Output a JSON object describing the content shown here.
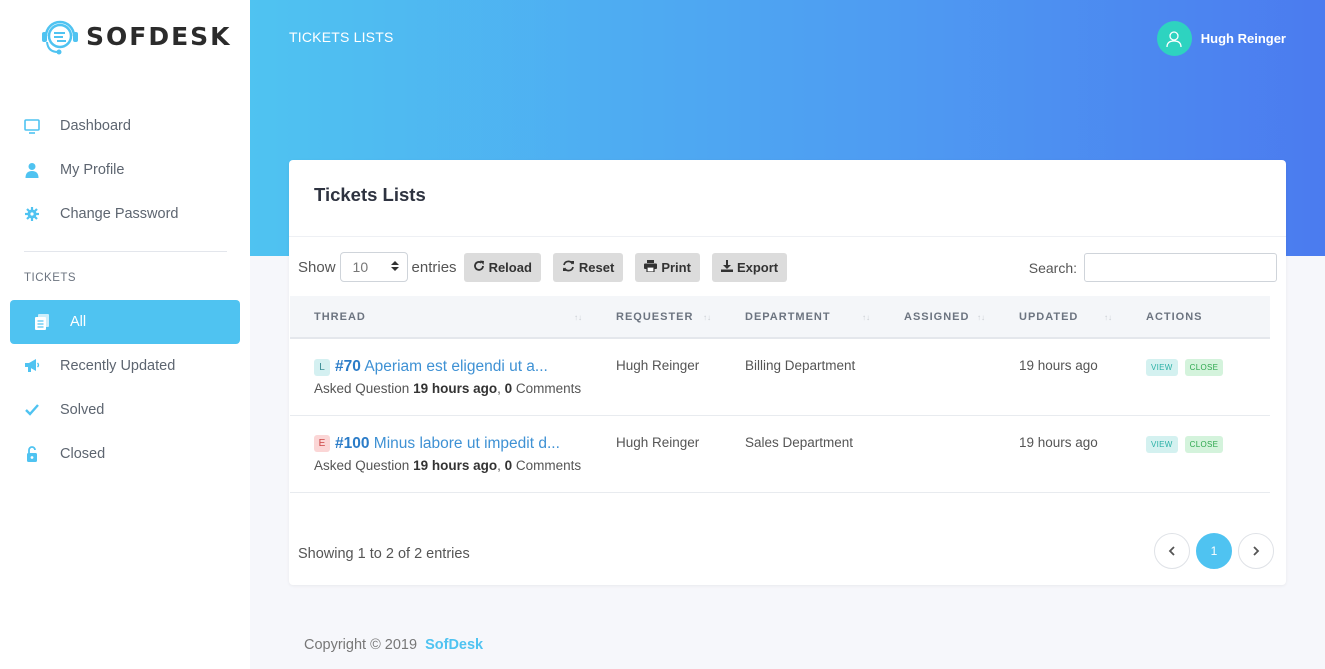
{
  "brand": {
    "name": "SOFDESK"
  },
  "sidebar": {
    "items": [
      {
        "label": "Dashboard",
        "icon": "monitor-icon"
      },
      {
        "label": "My Profile",
        "icon": "user-icon"
      },
      {
        "label": "Change Password",
        "icon": "gear-icon"
      }
    ],
    "section": "TICKETS",
    "tickets": [
      {
        "label": "All",
        "icon": "document-icon",
        "active": true
      },
      {
        "label": "Recently Updated",
        "icon": "megaphone-icon"
      },
      {
        "label": "Solved",
        "icon": "check-icon"
      },
      {
        "label": "Closed",
        "icon": "unlock-icon"
      }
    ]
  },
  "header": {
    "title": "TICKETS LISTS",
    "user_name": "Hugh Reinger"
  },
  "card": {
    "title": "Tickets Lists",
    "show_label": "Show",
    "entries_value": "10",
    "entries_label": "entries",
    "buttons": {
      "reload": "Reload",
      "reset": "Reset",
      "print": "Print",
      "export": "Export"
    },
    "search_label": "Search:",
    "search_value": ""
  },
  "table": {
    "headers": [
      "THREAD",
      "REQUESTER",
      "DEPARTMENT",
      "ASSIGNED",
      "UPDATED",
      "ACTIONS"
    ],
    "rows": [
      {
        "letter": "L",
        "id": "#70",
        "title": "Aperiam est eligendi ut a...",
        "asked": "Asked Question",
        "time": "19 hours ago",
        "comments_count": "0",
        "comments_label": "Comments",
        "requester": "Hugh Reinger",
        "department": "Billing Department",
        "assigned": "",
        "updated": "19 hours ago",
        "view": "VIEW",
        "close": "CLOSE"
      },
      {
        "letter": "E",
        "id": "#100",
        "title": "Minus labore ut impedit d...",
        "asked": "Asked Question",
        "time": "19 hours ago",
        "comments_count": "0",
        "comments_label": "Comments",
        "requester": "Hugh Reinger",
        "department": "Sales Department",
        "assigned": "",
        "updated": "19 hours ago",
        "view": "VIEW",
        "close": "CLOSE"
      }
    ]
  },
  "pagination": {
    "showing": "Showing 1 to 2 of 2 entries",
    "current": "1"
  },
  "footer": {
    "copyright": "Copyright © 2019",
    "brand": "SofDesk"
  },
  "colors": {
    "accent": "#4fc3f1",
    "gradient_end": "#4b7bef",
    "avatar": "#2ed3c0"
  }
}
